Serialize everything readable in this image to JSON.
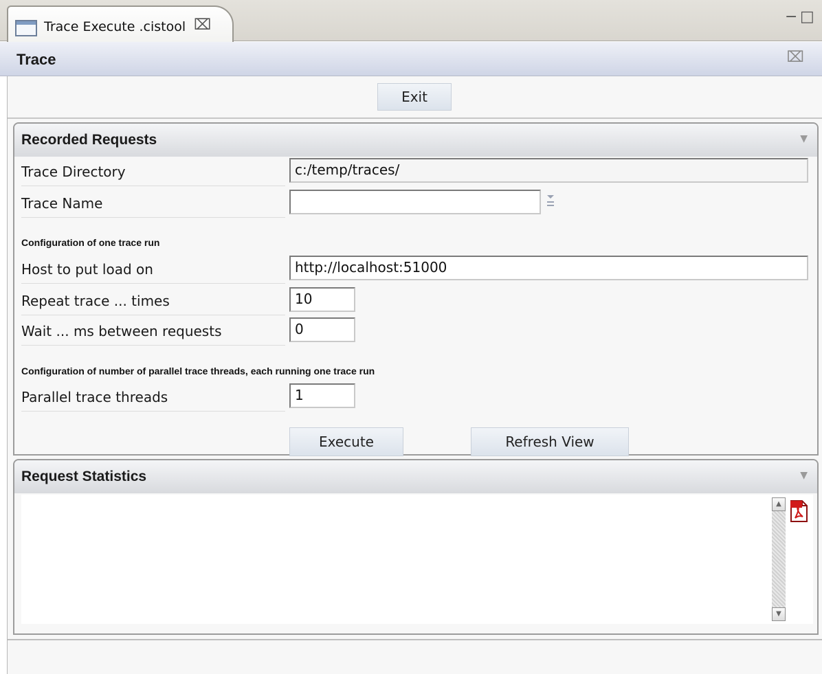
{
  "editor_tab": {
    "label": "Trace Execute .cistool",
    "close_glyph": "⌧"
  },
  "window_controls": {
    "minimize": "−",
    "maximize": "□"
  },
  "view": {
    "title": "Trace",
    "close_glyph": "⌧"
  },
  "exit_button": "Exit",
  "recorded_requests": {
    "title": "Recorded Requests",
    "trace_directory_label": "Trace Directory",
    "trace_directory_value": "c:/temp/traces/",
    "trace_name_label": "Trace Name",
    "trace_name_value": "",
    "config_one_run_heading": "Configuration of one trace run",
    "host_label": "Host to put load on",
    "host_value": "http://localhost:51000",
    "repeat_label": "Repeat trace ... times",
    "repeat_value": "10",
    "wait_label": "Wait ... ms between requests",
    "wait_value": "0",
    "config_parallel_heading": "Configuration of number of parallel trace threads, each running one trace run",
    "parallel_label": "Parallel trace threads",
    "parallel_value": "1",
    "execute_button": "Execute",
    "refresh_button": "Refresh View"
  },
  "request_statistics": {
    "title": "Request Statistics"
  },
  "icons": {
    "tab": "window-icon",
    "section_toggle": "chevron-down-icon",
    "trace_name_dropdown": "dropdown-icon",
    "export": "pdf-icon"
  },
  "colors": {
    "view_header": "#cfd5e6",
    "pdf_red": "#d11a1a"
  }
}
